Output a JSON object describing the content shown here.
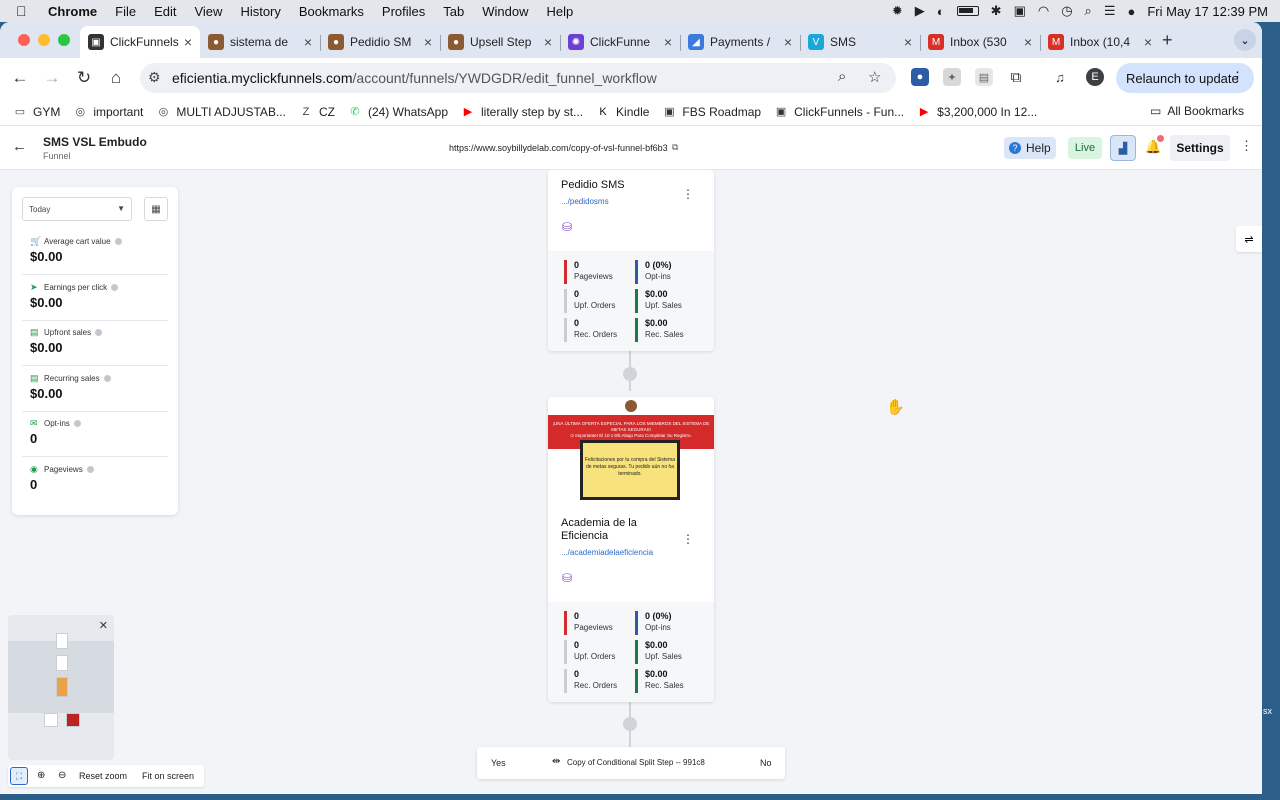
{
  "menubar": {
    "app": "Chrome",
    "items": [
      "File",
      "Edit",
      "View",
      "History",
      "Bookmarks",
      "Profiles",
      "Tab",
      "Window",
      "Help"
    ],
    "clock": "Fri May 17  12:39 PM"
  },
  "tabs": [
    {
      "label": "ClickFunnels",
      "color": "#333333",
      "glyph": "▣"
    },
    {
      "label": "sistema de",
      "color": "#8b5a33",
      "glyph": "●"
    },
    {
      "label": "Pedidio SM",
      "color": "#8b5a33",
      "glyph": "●"
    },
    {
      "label": "Upsell Step",
      "color": "#8b5a33",
      "glyph": "●"
    },
    {
      "label": "ClickFunne",
      "color": "#6b3fd4",
      "glyph": "✺"
    },
    {
      "label": "Payments /",
      "color": "#3b7be0",
      "glyph": "◢"
    },
    {
      "label": "SMS",
      "color": "#19a9d8",
      "glyph": "V"
    },
    {
      "label": "Inbox (530",
      "color": "#d93025",
      "glyph": "M"
    },
    {
      "label": "Inbox (10,4",
      "color": "#d93025",
      "glyph": "M"
    }
  ],
  "address": {
    "host": "eficientia.myclickfunnels.com",
    "path": "/account/funnels/YWDGDR/edit_funnel_workflow"
  },
  "relaunch_label": "Relaunch to update",
  "profile_initial": "E",
  "bookmarks": [
    {
      "label": "GYM",
      "glyph": "▭",
      "color": "#444444"
    },
    {
      "label": "important",
      "glyph": "◎",
      "color": "#444444"
    },
    {
      "label": "MULTI ADJUSTAB...",
      "glyph": "◎",
      "color": "#444444"
    },
    {
      "label": "CZ",
      "glyph": "Z",
      "color": "#444444"
    },
    {
      "label": "(24) WhatsApp",
      "glyph": "✆",
      "color": "#25d366"
    },
    {
      "label": "literally step by st...",
      "glyph": "▶",
      "color": "#ff0000"
    },
    {
      "label": "Kindle",
      "glyph": "K",
      "color": "#111111"
    },
    {
      "label": "FBS Roadmap",
      "glyph": "▣",
      "color": "#333333"
    },
    {
      "label": "ClickFunnels - Fun...",
      "glyph": "▣",
      "color": "#333333"
    },
    {
      "label": "$3,200,000 In 12...",
      "glyph": "▶",
      "color": "#ff0000"
    }
  ],
  "all_bookmarks": "All Bookmarks",
  "funnel": {
    "title": "SMS VSL Embudo",
    "subtitle": "Funnel",
    "url": "https://www.soybillydelab.com/copy-of-vsl-funnel-bf6b3"
  },
  "header_actions": {
    "help": "Help",
    "live": "Live",
    "settings": "Settings"
  },
  "stats_panel": {
    "range": "Today",
    "metrics": [
      {
        "label": "Average cart value",
        "value": "$0.00",
        "icon": "🛒"
      },
      {
        "label": "Earnings per click",
        "value": "$0.00",
        "icon": "➤"
      },
      {
        "label": "Upfront sales",
        "value": "$0.00",
        "icon": "▤"
      },
      {
        "label": "Recurring sales",
        "value": "$0.00",
        "icon": "▤"
      },
      {
        "label": "Opt-ins",
        "value": "0",
        "icon": "✉"
      },
      {
        "label": "Pageviews",
        "value": "0",
        "icon": "◉"
      }
    ]
  },
  "steps": [
    {
      "name": "Pedidio SMS",
      "path": ".../pedidosms",
      "stats": [
        {
          "value": "0",
          "label": "Pageviews",
          "color": "#d42a2a"
        },
        {
          "value": "0 (0%)",
          "label": "Opt-ins",
          "color": "#2b5ca5"
        },
        {
          "value": "0",
          "label": "Upf. Orders",
          "color": "#c9cdd3"
        },
        {
          "value": "$0.00",
          "label": "Upf. Sales",
          "color": "#1b7a45"
        },
        {
          "value": "0",
          "label": "Rec. Orders",
          "color": "#c9cdd3"
        },
        {
          "value": "$0.00",
          "label": "Rec. Sales",
          "color": "#1b7a45"
        }
      ]
    },
    {
      "name": "Academia de la Eficiencia",
      "path": ".../academiadelaeficiencia",
      "thumb_banner": "¡UNA ÚLTIMA OFERTA ESPECIAL PARA LOS MIEMBROS DEL SISTEMA DE METAS SEGURAS!",
      "thumb_sub": "⊙ Importante! El 10 x 9/5 Abajo Para Completar Su Registro.",
      "thumb_text": "Felicitaciones por tu compra del Sistema de metas seguras. Tu pedido aún no ha terminado.",
      "stats": [
        {
          "value": "0",
          "label": "Pageviews",
          "color": "#d42a2a"
        },
        {
          "value": "0 (0%)",
          "label": "Opt-ins",
          "color": "#2b5ca5"
        },
        {
          "value": "0",
          "label": "Upf. Orders",
          "color": "#c9cdd3"
        },
        {
          "value": "$0.00",
          "label": "Upf. Sales",
          "color": "#1b7a45"
        },
        {
          "value": "0",
          "label": "Rec. Orders",
          "color": "#c9cdd3"
        },
        {
          "value": "$0.00",
          "label": "Rec. Sales",
          "color": "#1b7a45"
        }
      ]
    }
  ],
  "split_step": {
    "yes": "Yes",
    "name": "Copy of Conditional Split Step -- 991c8",
    "no": "No"
  },
  "zoom": {
    "reset": "Reset zoom",
    "fit": "Fit on screen"
  },
  "side_label": "sx"
}
